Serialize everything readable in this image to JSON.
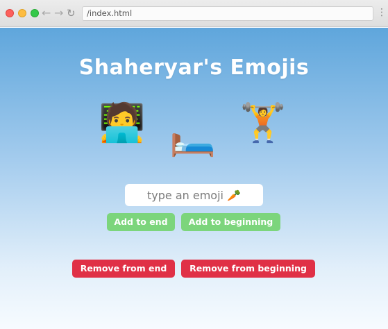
{
  "browser": {
    "url": "/index.html",
    "back_glyph": "←",
    "forward_glyph": "→",
    "reload_glyph": "↻",
    "menu_glyph": "⋮"
  },
  "page": {
    "title": "Shaheryar's Emojis",
    "emojis": [
      "🧑‍💻",
      "🛏️",
      "🏋️"
    ],
    "input": {
      "placeholder": "type an emoji 🥕",
      "value": ""
    },
    "buttons": {
      "add_to_end": "Add to end",
      "add_to_beginning": "Add to beginning",
      "remove_from_end": "Remove from end",
      "remove_from_beginning": "Remove from beginning"
    },
    "colors": {
      "add_button": "#7cd57c",
      "remove_button": "#e03046",
      "background_top": "#5fa6dc",
      "background_bottom": "#f7fbff"
    }
  }
}
